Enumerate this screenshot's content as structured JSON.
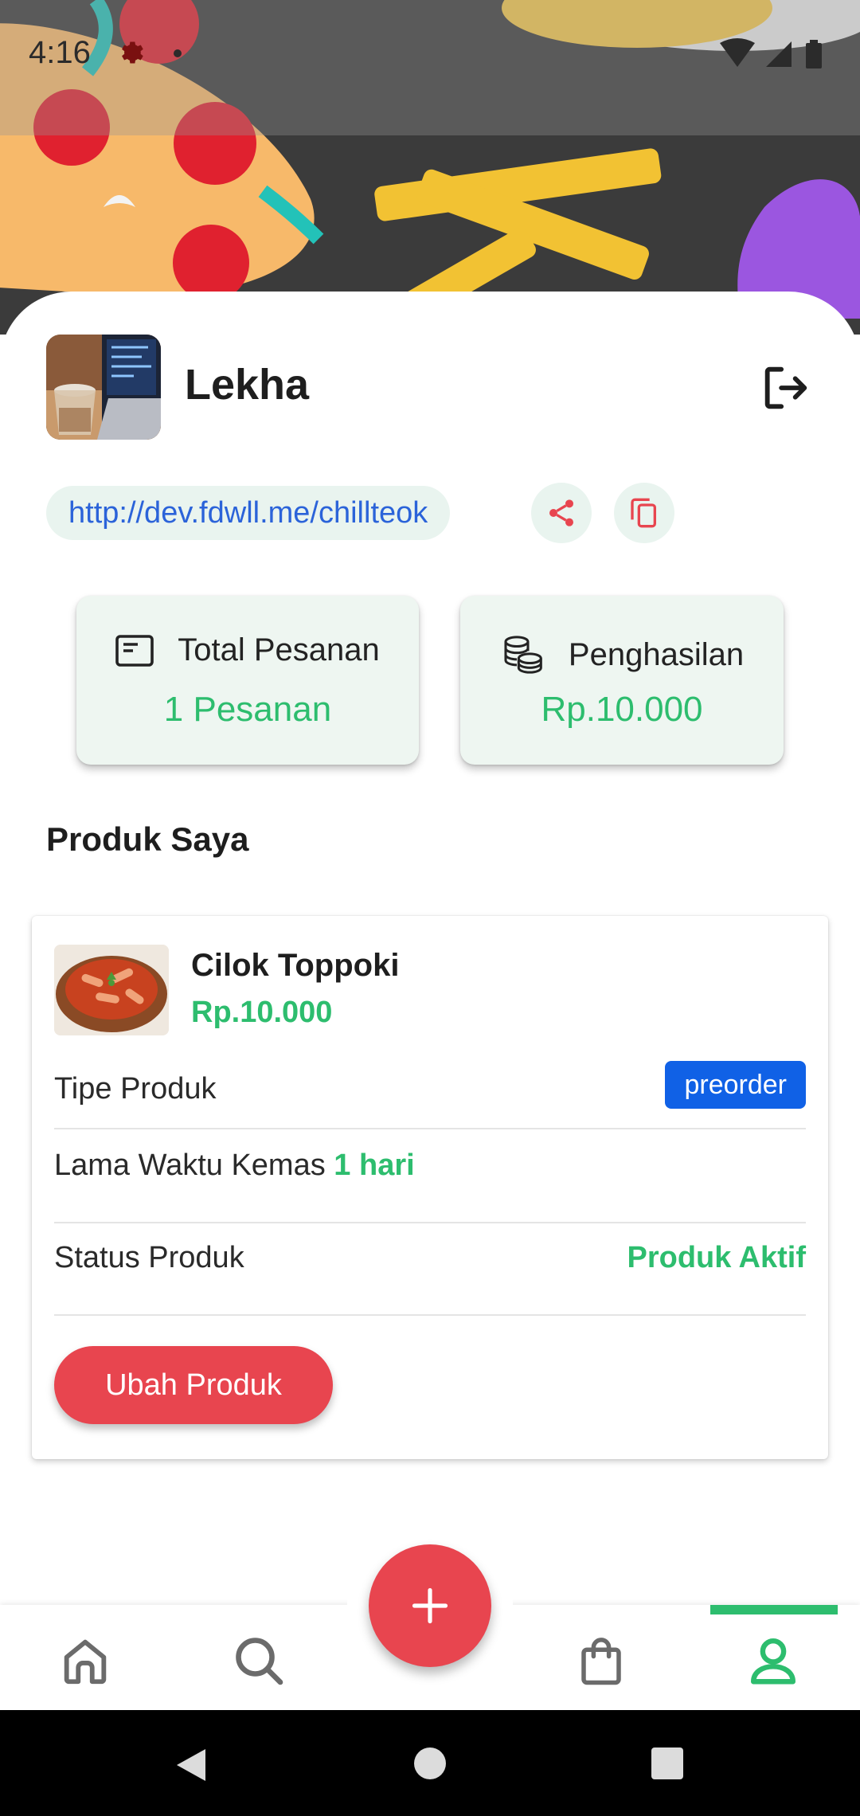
{
  "status_bar": {
    "time": "4:16"
  },
  "profile": {
    "name": "Lekha",
    "store_link": "http://dev.fdwll.me/chillteok"
  },
  "stats": {
    "orders": {
      "title": "Total Pesanan",
      "value": "1 Pesanan"
    },
    "income": {
      "title": "Penghasilan",
      "value": "Rp.10.000"
    }
  },
  "products": {
    "section_title": "Produk Saya",
    "item": {
      "name": "Cilok Toppoki",
      "price": "Rp.10.000",
      "type_label": "Tipe Produk",
      "type_value": "preorder",
      "packing_label": "Lama Waktu Kemas",
      "packing_value": "1 hari",
      "status_label": "Status Produk",
      "status_value": "Produk Aktif",
      "edit_label": "Ubah Produk"
    }
  },
  "fab_label": "+",
  "colors": {
    "primary_green": "#2dbd6e",
    "accent_red": "#e8454f",
    "badge_blue": "#1061e6",
    "link_blue": "#2b63d9"
  },
  "icons": [
    "gear-icon",
    "wifi-icon",
    "signal-icon",
    "battery-icon",
    "logout-icon",
    "share-icon",
    "copy-icon",
    "receipt-icon",
    "coins-icon",
    "home-icon",
    "search-icon",
    "bag-icon",
    "profile-icon",
    "plus-icon"
  ],
  "bottom_nav": {
    "active": "profile"
  }
}
